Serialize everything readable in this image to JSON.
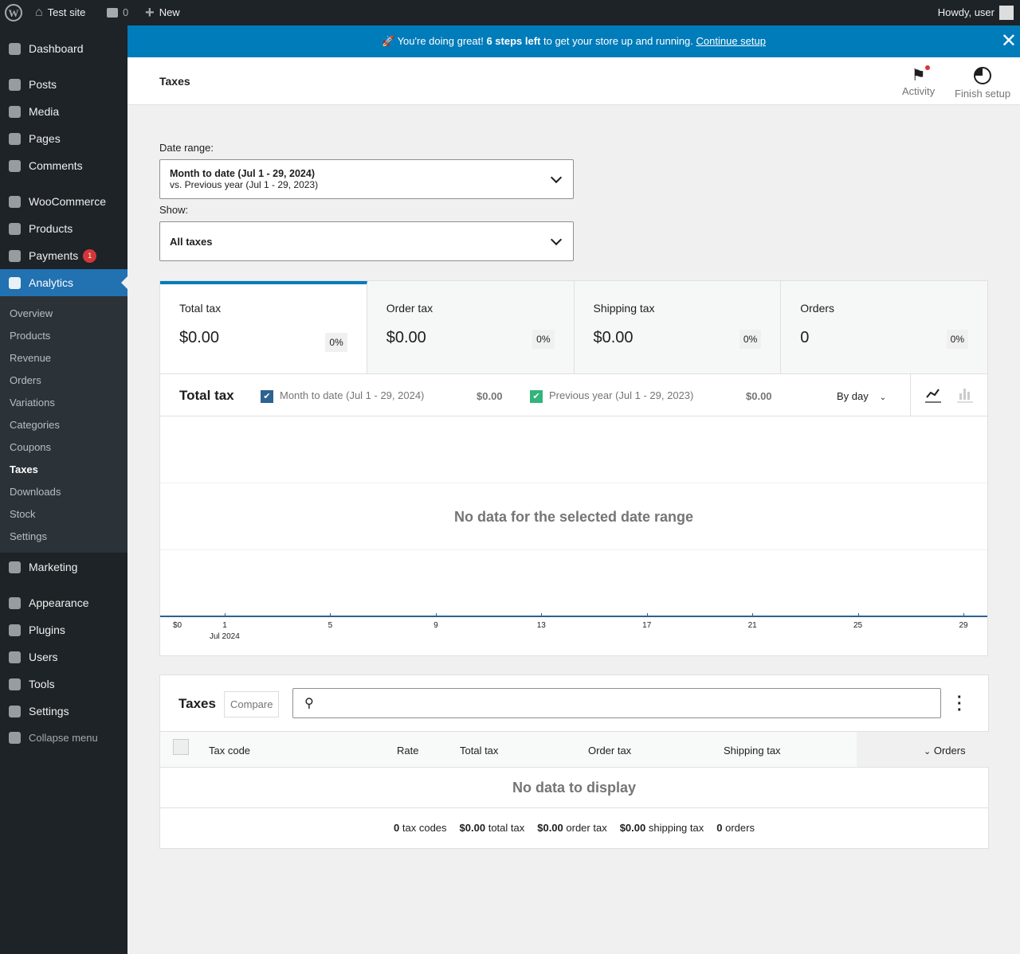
{
  "adminbar": {
    "site": "Test site",
    "comments": "0",
    "new": "New",
    "howdy": "Howdy, user"
  },
  "sidebar": {
    "items": [
      {
        "label": "Dashboard",
        "icon": "dashboard-icon"
      },
      {
        "label": "Posts",
        "icon": "pin-icon"
      },
      {
        "label": "Media",
        "icon": "media-icon"
      },
      {
        "label": "Pages",
        "icon": "pages-icon"
      },
      {
        "label": "Comments",
        "icon": "comment-icon"
      },
      {
        "label": "WooCommerce",
        "icon": "woo-icon"
      },
      {
        "label": "Products",
        "icon": "archive-icon"
      },
      {
        "label": "Payments",
        "icon": "dollar-icon",
        "badge": "1"
      },
      {
        "label": "Analytics",
        "icon": "bar-chart-icon"
      },
      {
        "label": "Marketing",
        "icon": "megaphone-icon"
      },
      {
        "label": "Appearance",
        "icon": "brush-icon"
      },
      {
        "label": "Plugins",
        "icon": "plugin-icon"
      },
      {
        "label": "Users",
        "icon": "user-icon"
      },
      {
        "label": "Tools",
        "icon": "wrench-icon"
      },
      {
        "label": "Settings",
        "icon": "settings-icon"
      },
      {
        "label": "Collapse menu",
        "icon": "collapse-icon"
      }
    ],
    "submenu": [
      "Overview",
      "Products",
      "Revenue",
      "Orders",
      "Variations",
      "Categories",
      "Coupons",
      "Taxes",
      "Downloads",
      "Stock",
      "Settings"
    ]
  },
  "banner": {
    "pre": "🚀 You're doing great! ",
    "bold": "6 steps left",
    "post": " to get your store up and running. ",
    "link": "Continue setup"
  },
  "header": {
    "title": "Taxes",
    "activity": "Activity",
    "finish": "Finish setup"
  },
  "filters": {
    "date_label": "Date range:",
    "date_main": "Month to date (Jul 1 - 29, 2024)",
    "date_compare": "vs. Previous year (Jul 1 - 29, 2023)",
    "show_label": "Show:",
    "show_value": "All taxes"
  },
  "summary": [
    {
      "title": "Total tax",
      "value": "$0.00",
      "delta": "0%"
    },
    {
      "title": "Order tax",
      "value": "$0.00",
      "delta": "0%"
    },
    {
      "title": "Shipping tax",
      "value": "$0.00",
      "delta": "0%"
    },
    {
      "title": "Orders",
      "value": "0",
      "delta": "0%"
    }
  ],
  "chart": {
    "title": "Total tax",
    "legend": [
      {
        "label": "Month to date (Jul 1 - 29, 2024)",
        "value": "$0.00",
        "color": "#2d6291"
      },
      {
        "label": "Previous year (Jul 1 - 29, 2023)",
        "value": "$0.00",
        "color": "#33b47a"
      }
    ],
    "interval": "By day",
    "empty": "No data for the selected date range",
    "y_tick": "$0",
    "x_ticks": [
      "1",
      "5",
      "9",
      "13",
      "17",
      "21",
      "25",
      "29"
    ],
    "x_sub": "Jul 2024"
  },
  "chart_data": {
    "type": "line",
    "x": [
      "1",
      "5",
      "9",
      "13",
      "17",
      "21",
      "25",
      "29"
    ],
    "series": [
      {
        "name": "Month to date (Jul 1 - 29, 2024)",
        "values": [
          0,
          0,
          0,
          0,
          0,
          0,
          0,
          0
        ]
      },
      {
        "name": "Previous year (Jul 1 - 29, 2023)",
        "values": [
          0,
          0,
          0,
          0,
          0,
          0,
          0,
          0
        ]
      }
    ],
    "xlabel": "Jul 2024",
    "ylabel": "",
    "grid": true
  },
  "table": {
    "title": "Taxes",
    "compare": "Compare",
    "columns": [
      "Tax code",
      "Rate",
      "Total tax",
      "Order tax",
      "Shipping tax",
      "Orders"
    ],
    "empty": "No data to display",
    "footer": [
      {
        "b": "0",
        "t": " tax codes"
      },
      {
        "b": "$0.00",
        "t": " total tax"
      },
      {
        "b": "$0.00",
        "t": " order tax"
      },
      {
        "b": "$0.00",
        "t": " shipping tax"
      },
      {
        "b": "0",
        "t": " orders"
      }
    ]
  }
}
